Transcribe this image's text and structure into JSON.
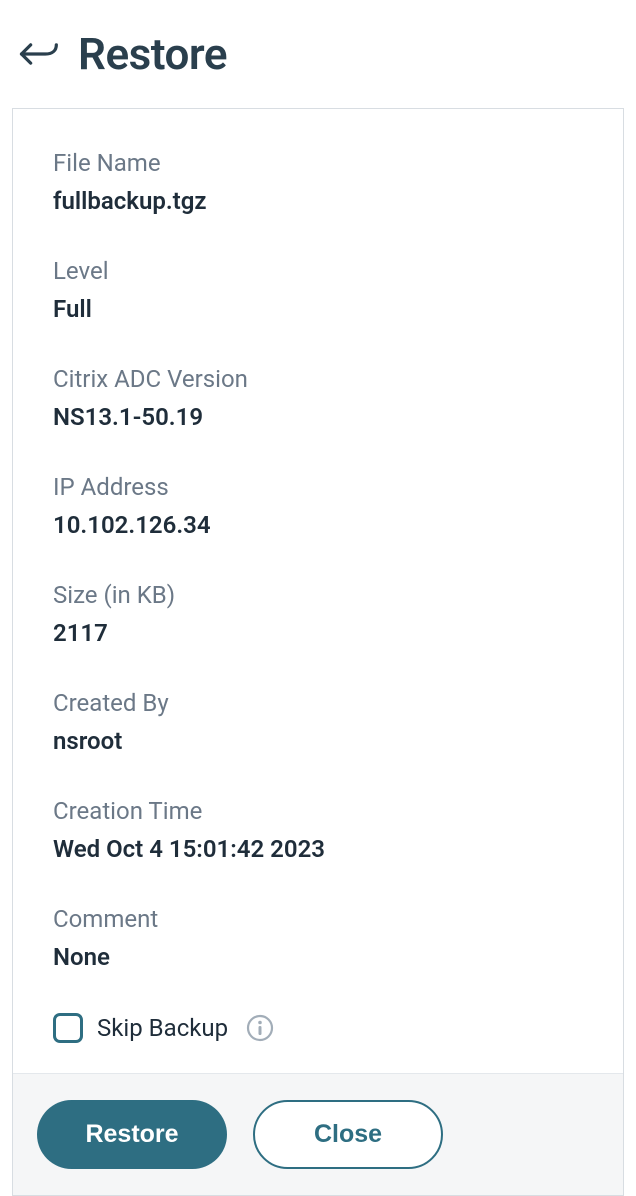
{
  "header": {
    "title": "Restore"
  },
  "fields": {
    "file_name": {
      "label": "File Name",
      "value": "fullbackup.tgz"
    },
    "level": {
      "label": "Level",
      "value": "Full"
    },
    "version": {
      "label": "Citrix ADC Version",
      "value": "NS13.1-50.19"
    },
    "ip": {
      "label": "IP Address",
      "value": "10.102.126.34"
    },
    "size": {
      "label": "Size (in KB)",
      "value": "2117"
    },
    "created_by": {
      "label": "Created By",
      "value": "nsroot"
    },
    "creation_time": {
      "label": "Creation Time",
      "value": "Wed Oct  4 15:01:42 2023"
    },
    "comment": {
      "label": "Comment",
      "value": "None"
    }
  },
  "checkbox": {
    "skip_backup": "Skip Backup"
  },
  "buttons": {
    "restore": "Restore",
    "close": "Close"
  }
}
